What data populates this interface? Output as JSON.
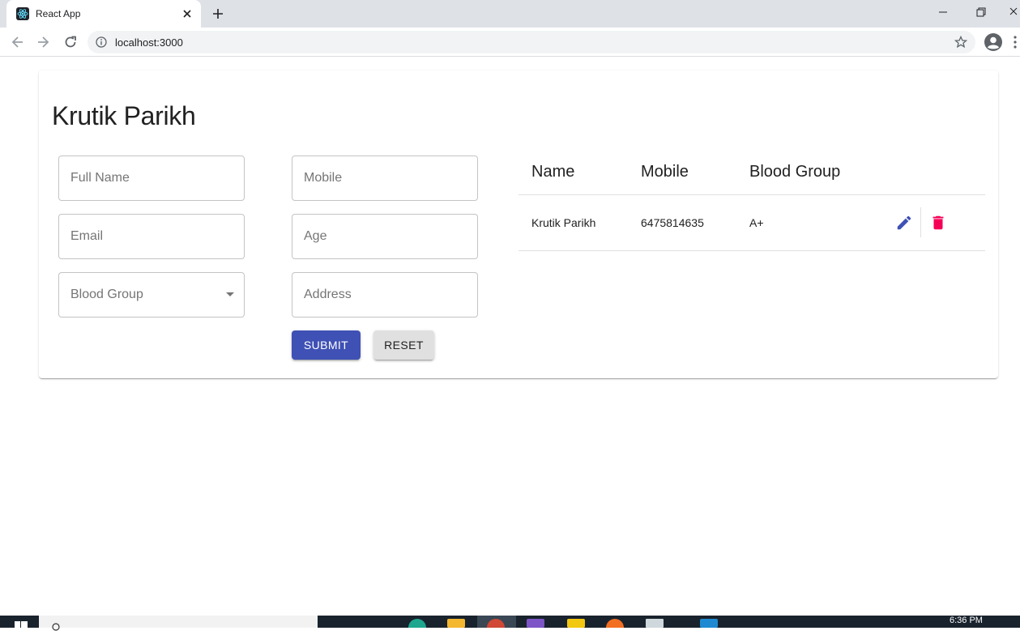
{
  "browser": {
    "tab_title": "React App",
    "url": "localhost:3000"
  },
  "page": {
    "heading": "Krutik Parikh",
    "form": {
      "full_name_placeholder": "Full Name",
      "mobile_placeholder": "Mobile",
      "email_placeholder": "Email",
      "age_placeholder": "Age",
      "blood_group_placeholder": "Blood Group",
      "address_placeholder": "Address",
      "submit_label": "SUBMIT",
      "reset_label": "RESET"
    },
    "table": {
      "headers": [
        "Name",
        "Mobile",
        "Blood Group"
      ],
      "rows": [
        {
          "name": "Krutik Parikh",
          "mobile": "6475814635",
          "blood_group": "A+"
        }
      ]
    }
  },
  "taskbar": {
    "time": "6:36 PM"
  },
  "colors": {
    "primary": "#3f51b5",
    "secondary": "#f50057",
    "reset_bg": "#e0e0e0"
  },
  "icons": [
    "react-logo-icon",
    "close-icon",
    "plus-icon",
    "back-icon",
    "forward-icon",
    "reload-icon",
    "info-icon",
    "star-icon",
    "profile-icon",
    "more-icon",
    "edit-icon",
    "delete-icon"
  ]
}
